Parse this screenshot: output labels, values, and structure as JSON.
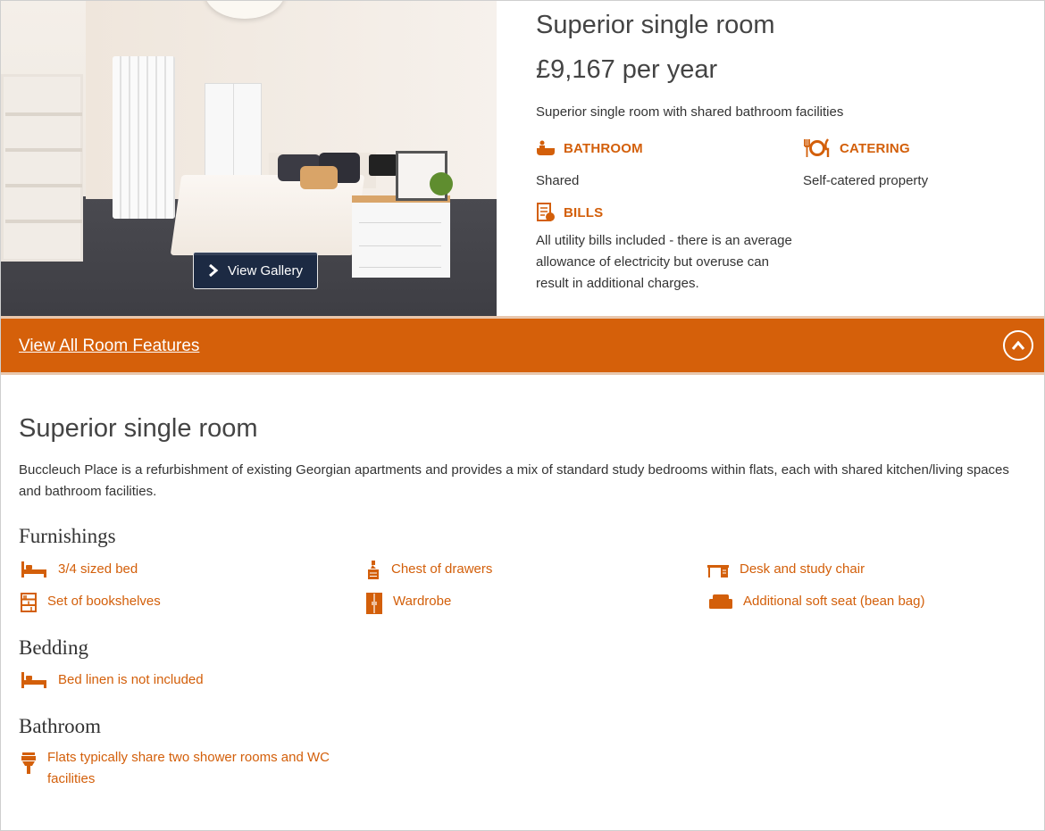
{
  "gallery": {
    "button_label": "View Gallery"
  },
  "summary": {
    "title": "Superior single room",
    "price": "£9,167 per year",
    "description": "Superior single room with shared bathroom facilities",
    "bathroom": {
      "label": "BATHROOM",
      "value": "Shared"
    },
    "catering": {
      "label": "CATERING",
      "value": "Self-catered property"
    },
    "bills": {
      "label": "BILLS",
      "value": "All utility bills included - there is an average allowance of electricity but overuse can result in additional charges."
    }
  },
  "features_bar": {
    "link_label": "View All Room Features"
  },
  "detail": {
    "title": "Superior single room",
    "about": "Buccleuch Place is a refurbishment of existing Georgian apartments and provides a mix of standard study bedrooms within flats, each with shared kitchen/living spaces and bathroom facilities.",
    "furnishings": {
      "heading": "Furnishings",
      "items": [
        "3/4 sized bed",
        "Chest of drawers",
        "Desk and study chair",
        "Set of bookshelves",
        "Wardrobe",
        "Additional soft seat (bean bag)"
      ]
    },
    "bedding": {
      "heading": "Bedding",
      "items": [
        "Bed linen is not included"
      ]
    },
    "bathroom": {
      "heading": "Bathroom",
      "items": [
        "Flats typically share two shower rooms and WC facilities"
      ]
    }
  },
  "colors": {
    "accent": "#d5600a",
    "accent_text": "#d35f0a",
    "text": "#333333",
    "gallery_button_bg": "#162642"
  },
  "icons": [
    "chevron-right-icon",
    "bath-icon",
    "cutlery-icon",
    "bill-icon",
    "chevron-up-icon",
    "bed-icon",
    "chest-of-drawers-icon",
    "desk-icon",
    "bookshelf-icon",
    "wardrobe-icon",
    "sofa-icon",
    "shower-icon"
  ]
}
